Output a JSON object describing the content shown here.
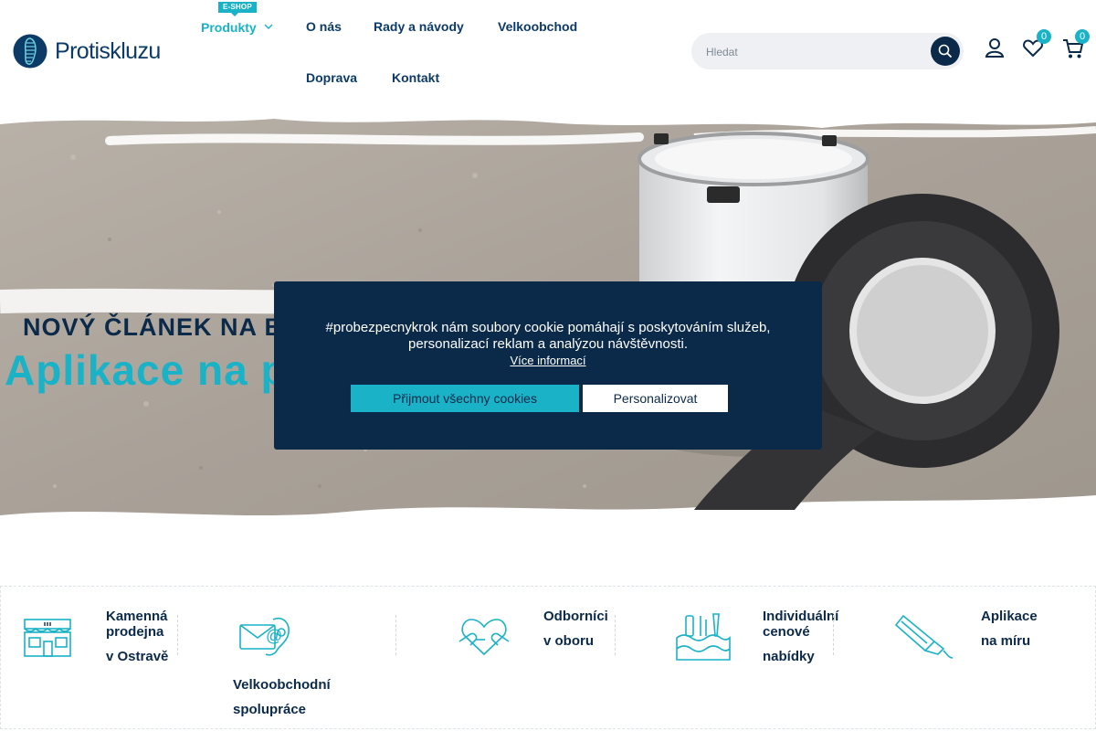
{
  "header": {
    "brand": "Protiskluzu",
    "nav": [
      {
        "label": "Produkty",
        "badge": "E-SHOP"
      },
      {
        "label": "O nás"
      },
      {
        "label": "Rady a návody"
      },
      {
        "label": "Velkoobchod"
      },
      {
        "label": "Doprava"
      },
      {
        "label": "Kontakt"
      }
    ],
    "search": {
      "placeholder": "Hledat",
      "icon": "search-icon"
    },
    "icons": {
      "account": "user-icon",
      "wishlist": "heart-icon",
      "cart": "cart-icon"
    },
    "wishlist_count": "0",
    "cart_count": "0"
  },
  "hero": {
    "pre_title": "NOVÝ ČLÁNEK NA BLOGU",
    "title": "Aplikace na protiskluzové pásky"
  },
  "cookie": {
    "text": "#probezpecnykrok nám soubory cookie pomáhají s poskytováním služeb, personalizací reklam a analýzou návštěvnosti.",
    "link": "Více informací",
    "accept_label": "Přijmout všechny cookies",
    "personalize_label": "Personalizovat"
  },
  "features": [
    {
      "icon": "store-icon",
      "line1": "Kamenná",
      "line2": "prodejna",
      "line3": "v Ostravě"
    },
    {
      "icon": "contact-icon",
      "line1": "Velkoobchodní",
      "line2": "spolupráce"
    },
    {
      "icon": "heart-hands-icon",
      "line1": "Odborníci",
      "line2": "v oboru"
    },
    {
      "icon": "tools-icon",
      "line1": "Individuální",
      "line2": "cenové",
      "line3": "nabídky"
    },
    {
      "icon": "tube-icon",
      "line1": "Aplikace",
      "line2": "na míru"
    }
  ],
  "colors": {
    "accent": "#19b2c7",
    "navy": "#0b2a4a",
    "text": "#0b3b66"
  }
}
